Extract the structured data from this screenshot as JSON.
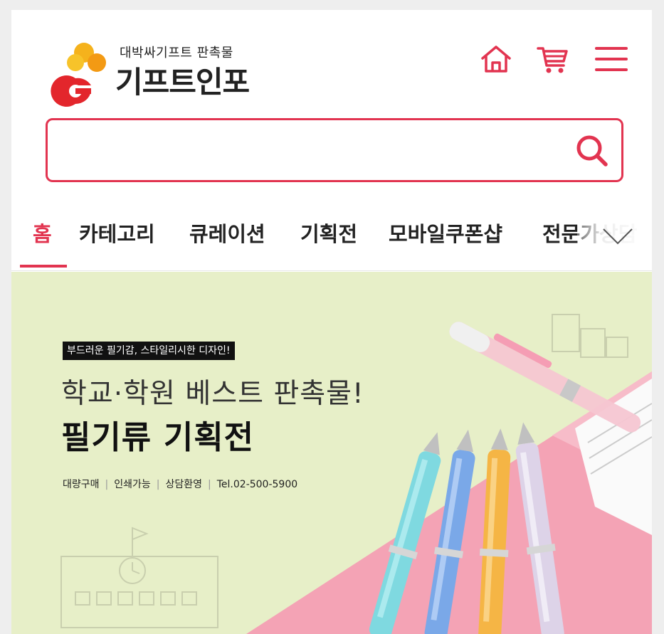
{
  "header": {
    "logo_sub": "대박싸기프트 판촉물",
    "logo_main": "기프트인포",
    "icons": [
      "home-icon",
      "cart-icon",
      "menu-icon"
    ]
  },
  "search": {
    "value": "",
    "placeholder": "",
    "icon": "search-icon"
  },
  "tabs": [
    {
      "label": "홈",
      "active": true
    },
    {
      "label": "카테고리"
    },
    {
      "label": "큐레이션"
    },
    {
      "label": "기획전"
    },
    {
      "label": "모바일쿠폰샵"
    },
    {
      "label": "전문가상담"
    }
  ],
  "tabs_toggle_icon": "chevron-down-icon",
  "banner": {
    "tagline": "부드러운 필기감, 스타일리시한 디자인!",
    "headline1": "학교·학원 베스트 판촉물!",
    "headline2": "필기류 기획전",
    "info": [
      "대량구매",
      "인쇄가능",
      "상담환영",
      "Tel.02-500-5900"
    ]
  },
  "colors": {
    "accent": "#e23450",
    "banner_bg": "#e7efc8",
    "banner_pink": "#f4a8b8"
  }
}
